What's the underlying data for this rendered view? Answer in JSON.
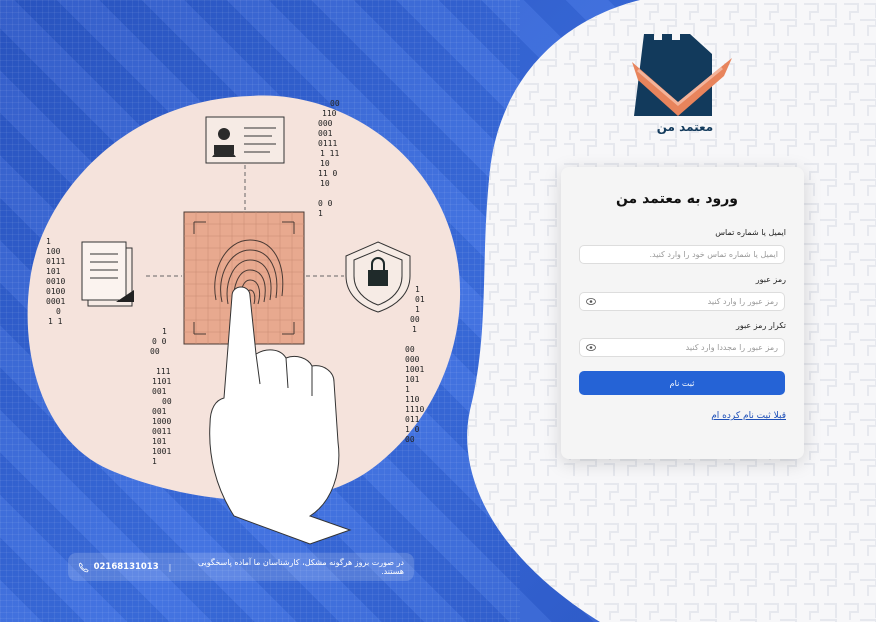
{
  "brand": {
    "name": "معتمد من"
  },
  "login_card": {
    "title": "ورود به معتمد من",
    "email_label": "ایمیل یا شماره تماس",
    "email_placeholder": "ایمیل یا شماره تماس خود را وارد کنید.",
    "password_label": "رمز عبور",
    "password_placeholder": "رمز عبور را وارد کنید",
    "confirm_label": "تکرار رمز عبور",
    "confirm_placeholder": "رمز عبور را مجددا وارد کنید",
    "submit_label": "ثبت نام",
    "login_link": "قبلا ثبت نام کرده ام"
  },
  "footer": {
    "support_text": "در صورت بروز هرگونه مشکل، کارشناسان ما آماده پاسخگویی هستند.",
    "separator": "|",
    "phone": "02168131013"
  },
  "colors": {
    "accent": "#2563d6",
    "brand_dark": "#123a5c",
    "brand_orange": "#e8845c",
    "background_blue": "#2d5fd0"
  },
  "icons": [
    "eye-icon",
    "phone-icon",
    "fingerprint-icon",
    "document-icon",
    "shield-lock-icon",
    "id-card-icon"
  ]
}
